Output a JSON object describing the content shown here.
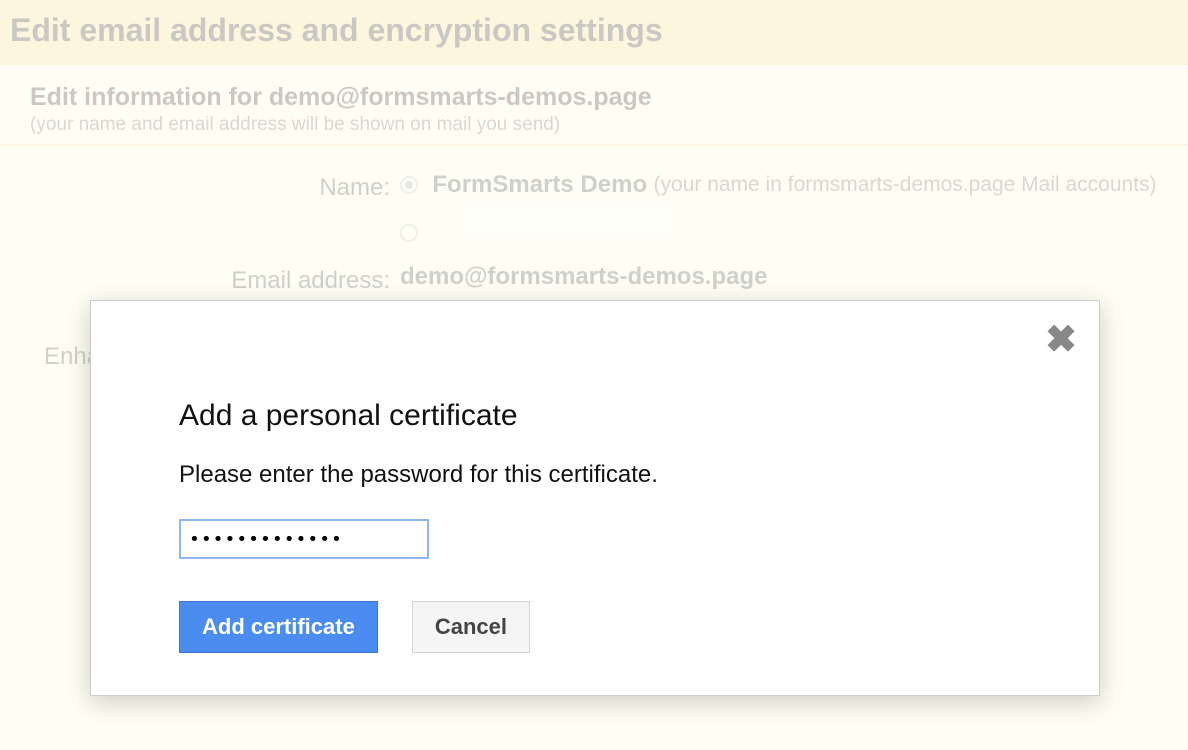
{
  "header": {
    "title": "Edit email address and encryption settings"
  },
  "subheader": {
    "main": "Edit information for demo@formsmarts-demos.page",
    "note": "(your name and email address will be shown on mail you send)"
  },
  "form": {
    "name_label": "Name:",
    "name_value": "FormSmarts Demo",
    "name_hint": "(your name in formsmarts-demos.page Mail accounts)",
    "email_label": "Email address:",
    "email_value": "demo@formsmarts-demos.page",
    "truncated_label": "Enha"
  },
  "modal": {
    "title": "Add a personal certificate",
    "text": "Please enter the password for this certificate.",
    "password_value": "•••••••••••••",
    "add_label": "Add certificate",
    "cancel_label": "Cancel"
  }
}
